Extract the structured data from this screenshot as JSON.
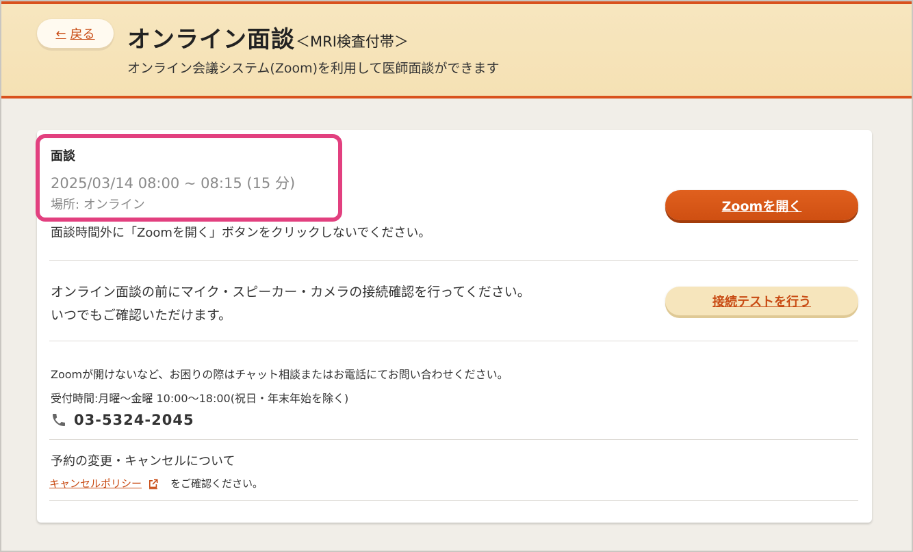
{
  "header": {
    "back_arrow": "←",
    "back_label": "戻る",
    "title": "オンライン面談",
    "title_tag": "＜MRI検査付帯＞",
    "description": "オンライン会議システム(Zoom)を利用して医師面談ができます"
  },
  "appointment": {
    "heading": "面談",
    "datetime": "2025/03/14 08:00 ~ 08:15 (15 分)",
    "location": "場所: オンライン",
    "warning": "面談時間外に「Zoomを開く」ボタンをクリックしないでください。",
    "zoom_button_label": "Zoomを開く"
  },
  "connection_test": {
    "line1": "オンライン面談の前にマイク・スピーカー・カメラの接続確認を行ってください。",
    "line2": "いつでもご確認いただけます。",
    "button_label": "接続テストを行う"
  },
  "support": {
    "help_text": "Zoomが開けないなど、お困りの際はチャット相談またはお電話にてお問い合わせください。",
    "hours_text": "受付時間:月曜～金曜 10:00～18:00(祝日・年末年始を除く)",
    "phone_icon": "phone-icon",
    "phone_number": "03-5324-2045"
  },
  "change": {
    "heading": "予約の変更・キャンセルについて",
    "policy_link": "キャンセルポリシー",
    "external_icon": "external-link-icon",
    "policy_suffix": "をご確認ください。"
  },
  "colors": {
    "accent": "#d9511c",
    "header_bg": "#f6e3b7",
    "highlight": "#e2407f",
    "link": "#c84a12"
  }
}
